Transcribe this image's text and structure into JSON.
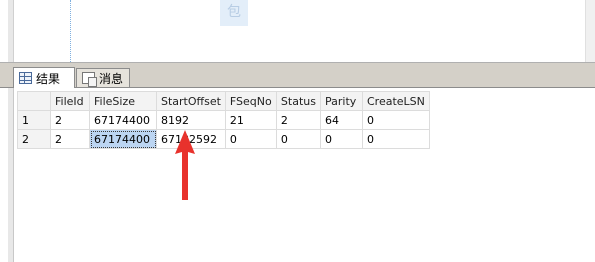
{
  "editor": {
    "glyph": "包"
  },
  "tabs": [
    {
      "label": "结果",
      "icon": "grid-icon",
      "active": true
    },
    {
      "label": "消息",
      "icon": "message-icon",
      "active": false
    }
  ],
  "grid": {
    "columns": [
      "FileId",
      "FileSize",
      "StartOffset",
      "FSeqNo",
      "Status",
      "Parity",
      "CreateLSN"
    ],
    "rows": [
      {
        "num": "1",
        "cells": [
          "2",
          "67174400",
          "8192",
          "21",
          "2",
          "64",
          "0"
        ]
      },
      {
        "num": "2",
        "cells": [
          "2",
          "67174400",
          "67182592",
          "0",
          "0",
          "0",
          "0"
        ]
      }
    ],
    "selected_cell": {
      "row": 2,
      "column": "FileSize"
    }
  },
  "annotation": {
    "arrow_color": "#e8322c",
    "points_to": "StartOffset 67182592"
  }
}
